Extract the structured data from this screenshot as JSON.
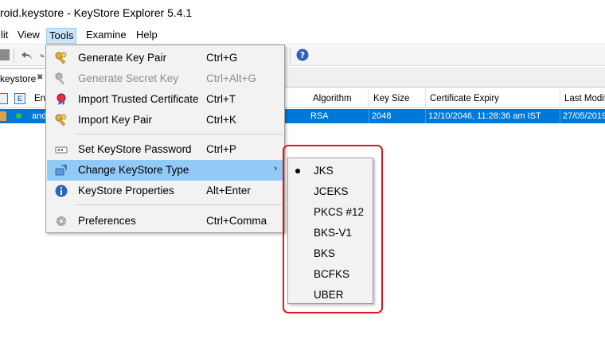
{
  "window": {
    "title": "roid.keystore - KeyStore Explorer 5.4.1"
  },
  "menubar": [
    {
      "label": "lit"
    },
    {
      "label": "View"
    },
    {
      "label": "Tools"
    },
    {
      "label": "Examine"
    },
    {
      "label": "Help"
    }
  ],
  "tab": {
    "label": "keystore",
    "close_glyph": "✖"
  },
  "table": {
    "headers": {
      "entry": "Ent",
      "algorithm": "Algorithm",
      "key_size": "Key Size",
      "expiry": "Certificate Expiry",
      "last_modified": "Last Modif"
    },
    "header_icon_letter": "E",
    "row": {
      "entry": "and",
      "algorithm": "RSA",
      "key_size": "2048",
      "expiry": "12/10/2046, 11:28:36 am IST",
      "last_modified": "27/05/2019"
    }
  },
  "tools_menu": {
    "items": [
      {
        "label": "Generate Key Pair",
        "accel": "Ctrl+G",
        "icon": "keys-icon",
        "enabled": true
      },
      {
        "label": "Generate Secret Key",
        "accel": "Ctrl+Alt+G",
        "icon": "secret-key-icon",
        "enabled": false
      },
      {
        "label": "Import Trusted Certificate",
        "accel": "Ctrl+T",
        "icon": "certificate-icon",
        "enabled": true
      },
      {
        "label": "Import Key Pair",
        "accel": "Ctrl+K",
        "icon": "import-keys-icon",
        "enabled": true
      },
      {
        "label": "Set KeyStore Password",
        "accel": "Ctrl+P",
        "icon": "password-icon",
        "enabled": true
      },
      {
        "label": "Change KeyStore Type",
        "accel": "",
        "icon": "change-type-icon",
        "enabled": true
      },
      {
        "label": "KeyStore Properties",
        "accel": "Alt+Enter",
        "icon": "info-icon",
        "enabled": true
      },
      {
        "label": "Preferences",
        "accel": "Ctrl+Comma",
        "icon": "gear-icon",
        "enabled": true
      }
    ],
    "submenu_arrow": "›"
  },
  "keystore_types": {
    "selected": "JKS",
    "options": [
      {
        "label": "JKS"
      },
      {
        "label": "JCEKS"
      },
      {
        "label": "PKCS #12"
      },
      {
        "label": "BKS-V1"
      },
      {
        "label": "BKS"
      },
      {
        "label": "BCFKS"
      },
      {
        "label": "UBER"
      }
    ]
  },
  "colors": {
    "selection": "#0078d7",
    "menu_highlight": "#91c9f7",
    "annotation_box": "#e8141b"
  }
}
